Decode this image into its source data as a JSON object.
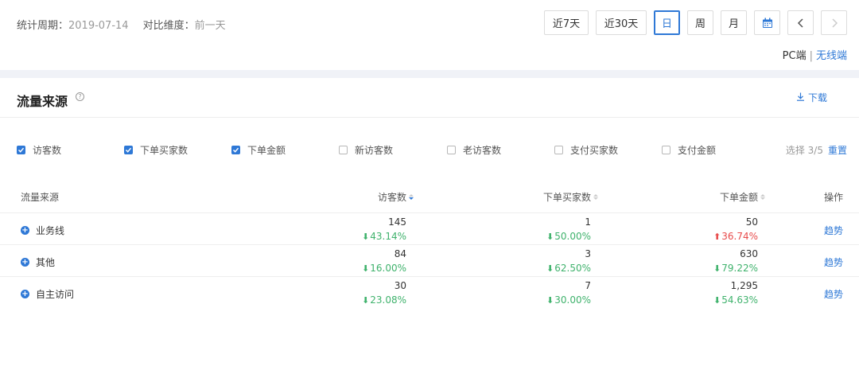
{
  "header": {
    "period_label": "统计周期：",
    "period_value": "2019-07-14",
    "compare_label": "对比维度：",
    "compare_value": "前一天",
    "buttons": {
      "last7": "近7天",
      "last30": "近30天",
      "day": "日",
      "week": "周",
      "month": "月"
    },
    "active_button": "日",
    "calendar_icon": "calendar-icon",
    "prev_icon": "chevron-left-icon",
    "next_icon": "chevron-right-icon",
    "terminal_pc": "PC端",
    "terminal_sep": "|",
    "terminal_wireless": "无线端"
  },
  "section": {
    "title": "流量来源",
    "help_icon": "?",
    "download_label": "下载",
    "download_icon": "download-icon"
  },
  "metrics": [
    {
      "label": "访客数",
      "checked": true
    },
    {
      "label": "下单买家数",
      "checked": true
    },
    {
      "label": "下单金额",
      "checked": true
    },
    {
      "label": "新访客数",
      "checked": false
    },
    {
      "label": "老访客数",
      "checked": false
    },
    {
      "label": "支付买家数",
      "checked": false
    },
    {
      "label": "支付金额",
      "checked": false
    }
  ],
  "select_info": {
    "label": "选择 3/5",
    "reset": "重置"
  },
  "table": {
    "headers": {
      "source": "流量来源",
      "visitors": "访客数",
      "buyers": "下单买家数",
      "amount": "下单金额",
      "action": "操作"
    },
    "rows": [
      {
        "source": "业务线",
        "visitors": "145",
        "visitors_chg": "43.14%",
        "visitors_dir": "down",
        "buyers": "1",
        "buyers_chg": "50.00%",
        "buyers_dir": "down",
        "amount": "50",
        "amount_chg": "36.74%",
        "amount_dir": "up",
        "action": "趋势"
      },
      {
        "source": "其他",
        "visitors": "84",
        "visitors_chg": "16.00%",
        "visitors_dir": "down",
        "buyers": "3",
        "buyers_chg": "62.50%",
        "buyers_dir": "down",
        "amount": "630",
        "amount_chg": "79.22%",
        "amount_dir": "down",
        "action": "趋势"
      },
      {
        "source": "自主访问",
        "visitors": "30",
        "visitors_chg": "23.08%",
        "visitors_dir": "down",
        "buyers": "7",
        "buyers_chg": "30.00%",
        "buyers_dir": "down",
        "amount": "1,295",
        "amount_chg": "54.63%",
        "amount_dir": "down",
        "action": "趋势"
      }
    ]
  },
  "colors": {
    "accent": "#2e78d6",
    "decrease": "#3fb26c",
    "increase": "#e84b4b",
    "divider": "#f0f2f7"
  }
}
